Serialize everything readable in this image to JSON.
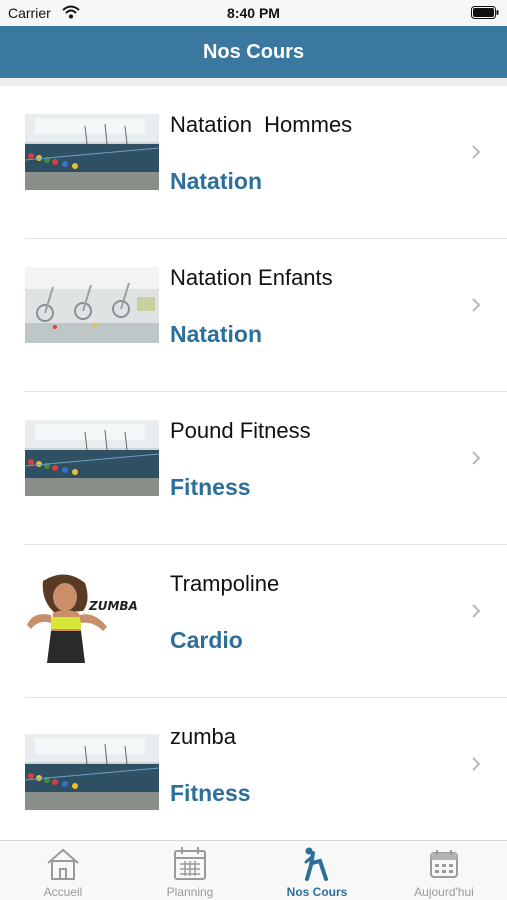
{
  "status_bar": {
    "carrier": "Carrier",
    "time": "8:40 PM"
  },
  "nav": {
    "title": "Nos Cours"
  },
  "courses": [
    {
      "title": "Natation  Hommes",
      "category": "Natation",
      "image": "pool-thumbnail"
    },
    {
      "title": "Natation Enfants",
      "category": "Natation",
      "image": "gym-bikes-thumbnail"
    },
    {
      "title": "Pound Fitness",
      "category": "Fitness",
      "image": "pool-thumbnail"
    },
    {
      "title": "Trampoline",
      "category": "Cardio",
      "image": "zumba-thumbnail",
      "image_text": "ZUMBA"
    },
    {
      "title": "zumba",
      "category": "Fitness",
      "image": "pool-thumbnail"
    }
  ],
  "tabs": [
    {
      "label": "Accueil",
      "icon": "home-icon",
      "active": false
    },
    {
      "label": "Planning",
      "icon": "calendar-grid-icon",
      "active": false
    },
    {
      "label": "Nos Cours",
      "icon": "running-person-icon",
      "active": true
    },
    {
      "label": "Aujourd'hui",
      "icon": "calendar-icon",
      "active": false
    }
  ],
  "colors": {
    "nav": "#3a78a0",
    "accent": "#2c6f9a",
    "inactive_tab": "#9a9a9a"
  }
}
